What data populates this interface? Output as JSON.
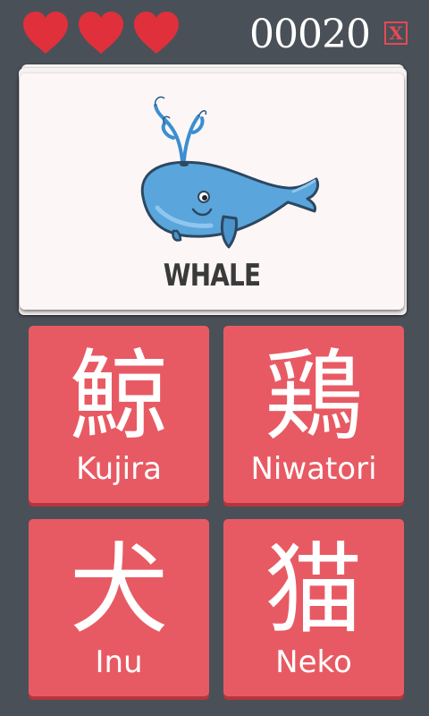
{
  "header": {
    "lives": 3,
    "life_icon": "heart-icon",
    "score": "00020",
    "close_label": "X"
  },
  "card": {
    "word": "WHALE",
    "picture": "whale-illustration"
  },
  "options": [
    {
      "kanji": "鯨",
      "romaji": "Kujira"
    },
    {
      "kanji": "鶏",
      "romaji": "Niwatori"
    },
    {
      "kanji": "犬",
      "romaji": "Inu"
    },
    {
      "kanji": "猫",
      "romaji": "Neko"
    }
  ],
  "colors": {
    "background": "#4a5058",
    "heart": "#e0303c",
    "tile": "#e85a63",
    "tile_shadow": "#b8343c",
    "close": "#e44a55",
    "card": "#fdf6f6"
  }
}
